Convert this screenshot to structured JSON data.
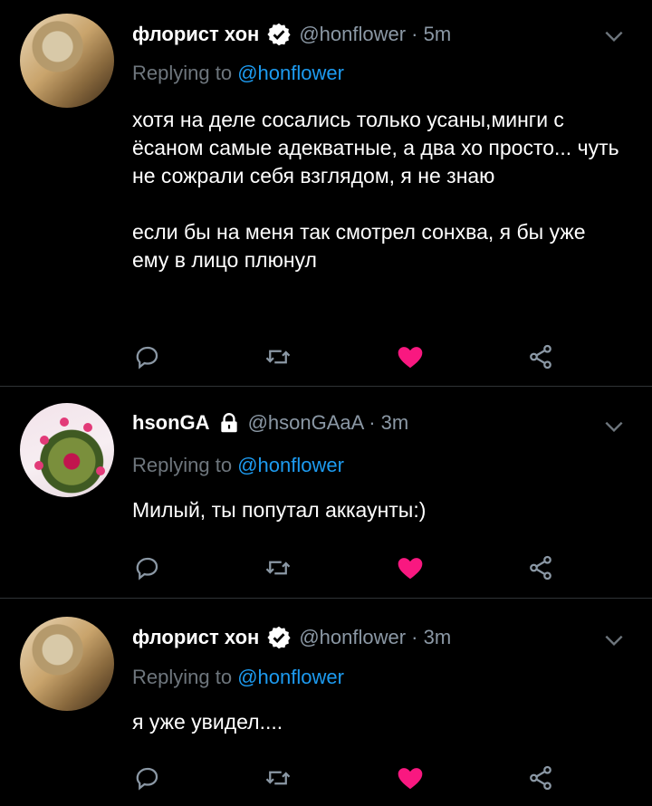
{
  "tweets": [
    {
      "name": "флорист хон",
      "handle": "@honflower",
      "time": "5m",
      "replying_prefix": "Replying to ",
      "replying_to": "@honflower",
      "paragraph1": "хотя на деле сосались только усаны,минги с ёсаном самые адекватные, а два хо просто... чуть не сожрали себя взглядом, я не знаю",
      "paragraph2": "если бы на меня так смотрел сонхва, я бы уже ему в лицо плюнул",
      "verified": true,
      "liked": true
    },
    {
      "name": "hsonGA",
      "handle": "@hsonGAaA",
      "time": "3m",
      "replying_prefix": "Replying to ",
      "replying_to": "@honflower",
      "paragraph1": "Милый, ты попутал аккаунты:)",
      "protected": true,
      "liked": true
    },
    {
      "name": "флорист хон",
      "handle": "@honflower",
      "time": "3m",
      "replying_prefix": "Replying to ",
      "replying_to": "@honflower",
      "paragraph1": "я уже увидел....",
      "verified": true,
      "liked": true
    }
  ],
  "separator": " · ",
  "colors": {
    "background": "#000000",
    "secondary_text": "#6e767d",
    "link": "#1d9bf0",
    "like": "#f91880",
    "icon": "#8b98a5"
  },
  "icons": [
    "reply-icon",
    "retweet-icon",
    "like-icon",
    "share-icon",
    "verified-badge-icon",
    "lock-icon",
    "chevron-down-icon"
  ]
}
